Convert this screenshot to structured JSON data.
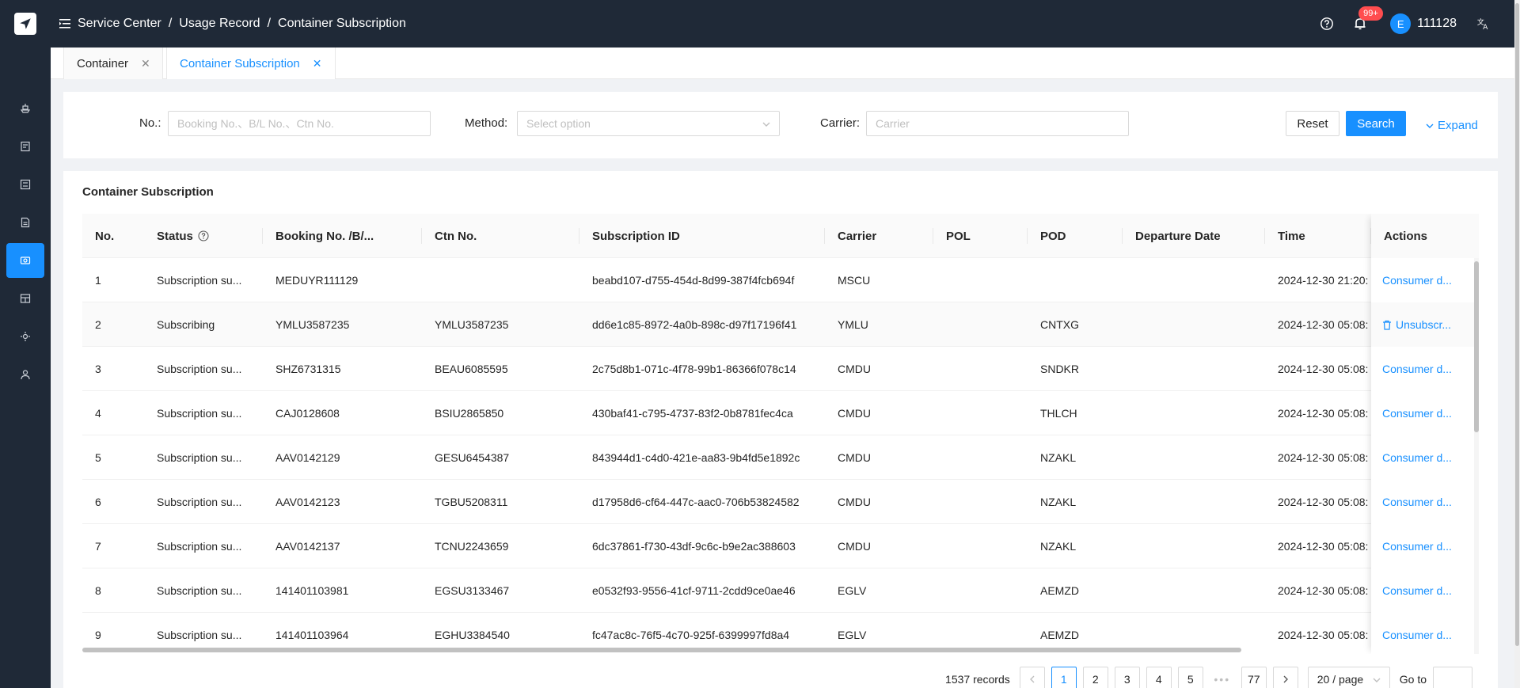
{
  "sidebar": {
    "logo_icon": "paper-plane-icon",
    "items": [
      {
        "icon": "ship-icon",
        "active": false
      },
      {
        "icon": "document-icon",
        "active": false
      },
      {
        "icon": "list-icon",
        "active": false
      },
      {
        "icon": "file-icon",
        "active": false
      },
      {
        "icon": "service-icon",
        "active": true
      },
      {
        "icon": "table-icon",
        "active": false
      },
      {
        "icon": "settings-icon",
        "active": false
      },
      {
        "icon": "user-icon",
        "active": false
      }
    ]
  },
  "header": {
    "breadcrumbs": [
      "Service Center",
      "Usage Record",
      "Container Subscription"
    ],
    "notification_badge": "99+",
    "avatar_letter": "E",
    "username": "111128"
  },
  "tabs": [
    {
      "label": "Container",
      "active": false
    },
    {
      "label": "Container Subscription",
      "active": true
    }
  ],
  "filter": {
    "no_label": "No.:",
    "no_placeholder": "Booking No.、B/L No.、Ctn No.",
    "method_label": "Method:",
    "method_placeholder": "Select option",
    "carrier_label": "Carrier:",
    "carrier_placeholder": "Carrier",
    "reset_label": "Reset",
    "search_label": "Search",
    "expand_label": "Expand"
  },
  "table": {
    "title": "Container Subscription",
    "columns": [
      "No.",
      "Status",
      "Booking No. /B/...",
      "Ctn No.",
      "Subscription ID",
      "Carrier",
      "POL",
      "POD",
      "Departure Date",
      "Time",
      "Actions"
    ],
    "rows": [
      {
        "no": "1",
        "status": "Subscription su...",
        "booking": "MEDUYR111129",
        "ctn": "",
        "sub_id": "beabd107-d755-454d-8d99-387f4fcb694f",
        "carrier": "MSCU",
        "pol": "",
        "pod": "",
        "departure": "",
        "time": "2024-12-30 21:20:",
        "action": "Consumer d..."
      },
      {
        "no": "2",
        "status": "Subscribing",
        "booking": "YMLU3587235",
        "ctn": "YMLU3587235",
        "sub_id": "dd6e1c85-8972-4a0b-898c-d97f17196f41",
        "carrier": "YMLU",
        "pol": "",
        "pod": "CNTXG",
        "departure": "",
        "time": "2024-12-30 05:08:",
        "action": "Unsubscr..."
      },
      {
        "no": "3",
        "status": "Subscription su...",
        "booking": "SHZ6731315",
        "ctn": "BEAU6085595",
        "sub_id": "2c75d8b1-071c-4f78-99b1-86366f078c14",
        "carrier": "CMDU",
        "pol": "",
        "pod": "SNDKR",
        "departure": "",
        "time": "2024-12-30 05:08:",
        "action": "Consumer d..."
      },
      {
        "no": "4",
        "status": "Subscription su...",
        "booking": "CAJ0128608",
        "ctn": "BSIU2865850",
        "sub_id": "430baf41-c795-4737-83f2-0b8781fec4ca",
        "carrier": "CMDU",
        "pol": "",
        "pod": "THLCH",
        "departure": "",
        "time": "2024-12-30 05:08:",
        "action": "Consumer d..."
      },
      {
        "no": "5",
        "status": "Subscription su...",
        "booking": "AAV0142129",
        "ctn": "GESU6454387",
        "sub_id": "843944d1-c4d0-421e-aa83-9b4fd5e1892c",
        "carrier": "CMDU",
        "pol": "",
        "pod": "NZAKL",
        "departure": "",
        "time": "2024-12-30 05:08:",
        "action": "Consumer d..."
      },
      {
        "no": "6",
        "status": "Subscription su...",
        "booking": "AAV0142123",
        "ctn": "TGBU5208311",
        "sub_id": "d17958d6-cf64-447c-aac0-706b53824582",
        "carrier": "CMDU",
        "pol": "",
        "pod": "NZAKL",
        "departure": "",
        "time": "2024-12-30 05:08:",
        "action": "Consumer d..."
      },
      {
        "no": "7",
        "status": "Subscription su...",
        "booking": "AAV0142137",
        "ctn": "TCNU2243659",
        "sub_id": "6dc37861-f730-43df-9c6c-b9e2ac388603",
        "carrier": "CMDU",
        "pol": "",
        "pod": "NZAKL",
        "departure": "",
        "time": "2024-12-30 05:08:",
        "action": "Consumer d..."
      },
      {
        "no": "8",
        "status": "Subscription su...",
        "booking": "141401103981",
        "ctn": "EGSU3133467",
        "sub_id": "e0532f93-9556-41cf-9711-2cdd9ce0ae46",
        "carrier": "EGLV",
        "pol": "",
        "pod": "AEMZD",
        "departure": "",
        "time": "2024-12-30 05:08:",
        "action": "Consumer d..."
      },
      {
        "no": "9",
        "status": "Subscription su...",
        "booking": "141401103964",
        "ctn": "EGHU3384540",
        "sub_id": "fc47ac8c-76f5-4c70-925f-6399997fd8a4",
        "carrier": "EGLV",
        "pol": "",
        "pod": "AEMZD",
        "departure": "",
        "time": "2024-12-30 05:08:",
        "action": "Consumer d..."
      }
    ]
  },
  "pagination": {
    "total": "1537 records",
    "pages": [
      "1",
      "2",
      "3",
      "4",
      "5"
    ],
    "ellipsis": "•••",
    "last_page": "77",
    "current": "1",
    "page_size": "20 / page",
    "goto_label": "Go to"
  },
  "colors": {
    "primary": "#1890ff",
    "sidebar_bg": "#1f2937",
    "badge": "#ff4d4f"
  }
}
